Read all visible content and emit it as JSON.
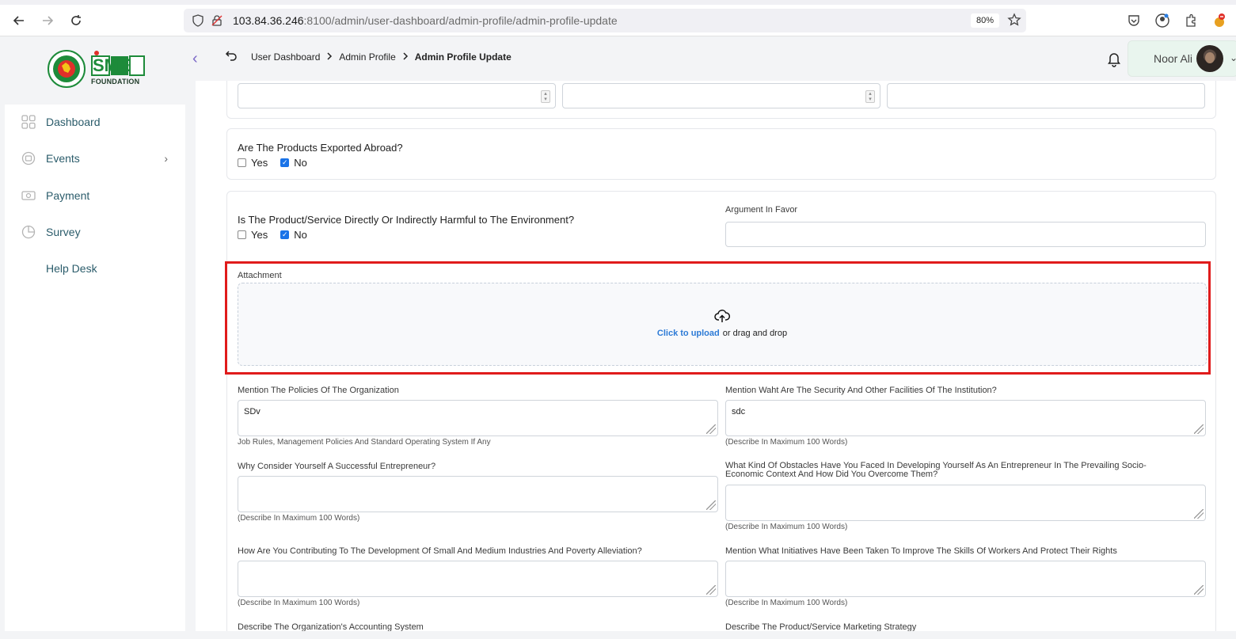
{
  "browser": {
    "url_host": "103.84.36.246",
    "url_rest": ":8100/admin/user-dashboard/admin-profile/admin-profile-update",
    "zoom": "80%"
  },
  "logo": {
    "brand": "SME",
    "subtitle": "FOUNDATION"
  },
  "sidebar": {
    "items": [
      {
        "label": "Dashboard",
        "icon": "grid-icon"
      },
      {
        "label": "Events",
        "icon": "event-icon",
        "has_children": true
      },
      {
        "label": "Payment",
        "icon": "payment-icon"
      },
      {
        "label": "Survey",
        "icon": "pie-chart-icon"
      },
      {
        "label": "Help Desk",
        "icon": ""
      }
    ]
  },
  "header": {
    "breadcrumb": [
      "User Dashboard",
      "Admin Profile",
      "Admin Profile Update"
    ],
    "user_name": "Noor Ali"
  },
  "form": {
    "exported": {
      "question": "Are The Products Exported Abroad?",
      "yes_label": "Yes",
      "no_label": "No",
      "selected": "No"
    },
    "harmful": {
      "question": "Is The Product/Service Directly Or Indirectly Harmful to The Environment?",
      "yes_label": "Yes",
      "no_label": "No",
      "selected": "No"
    },
    "argument": {
      "label": "Argument In Favor",
      "value": ""
    },
    "attachment": {
      "label": "Attachment",
      "link_text": "Click to upload",
      "rest_text": "or drag and drop"
    },
    "policies": {
      "label": "Mention The Policies Of The Organization",
      "value": "SDv",
      "help": "Job Rules, Management Policies And Standard Operating System If Any"
    },
    "security": {
      "label": "Mention Waht Are The Security And Other Facilities Of The Institution?",
      "value": "sdc",
      "help": "(Describe In Maximum 100 Words)"
    },
    "successful": {
      "label": "Why Consider Yourself A Successful Entrepreneur?",
      "value": "",
      "help": "(Describe In Maximum 100 Words)"
    },
    "obstacles": {
      "label_line1": "What Kind Of Obstacles Have You Faced In Developing Yourself As An Entrepreneur In The Prevailing Socio-",
      "label_line2": "Economic Context And How Did You Overcome Them?",
      "value": "",
      "help": "(Describe In Maximum 100 Words)"
    },
    "contributing": {
      "label": "How Are You Contributing To The Development Of Small And Medium Industries And Poverty Alleviation?",
      "value": "",
      "help": "(Describe In Maximum 100 Words)"
    },
    "initiatives": {
      "label": "Mention What Initiatives Have Been Taken To Improve The Skills Of Workers And Protect Their Rights",
      "value": "",
      "help": "(Describe In Maximum 100 Words)"
    },
    "accounting": {
      "label": "Describe The Organization's Accounting System"
    },
    "marketing": {
      "label": "Describe The Product/Service Marketing Strategy"
    }
  },
  "colors": {
    "accent_link": "#2d7bd6",
    "highlight_border": "#e01b1b",
    "sidebar_text": "#2b5c6b",
    "checkbox_checked": "#1a73e8"
  }
}
